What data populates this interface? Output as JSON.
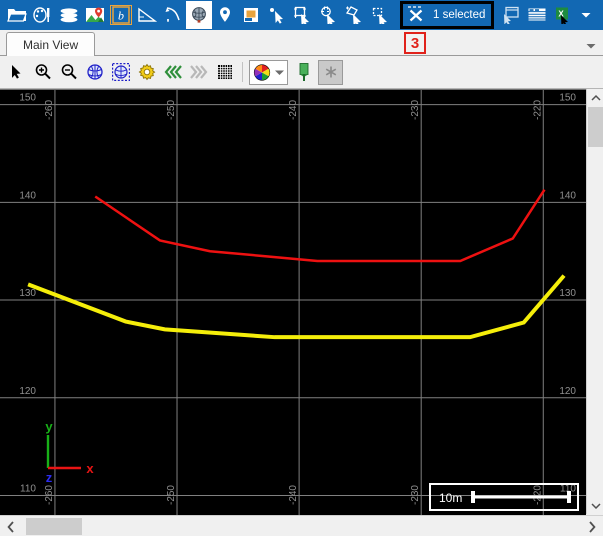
{
  "ribbon": {
    "icons": [
      {
        "name": "open-folder-icon",
        "label": "Open"
      },
      {
        "name": "palette-tools-icon",
        "label": "Design"
      },
      {
        "name": "layers-icon",
        "label": "Layers"
      },
      {
        "name": "map-pin-image-icon",
        "label": "Map"
      },
      {
        "name": "bing-maps-icon",
        "label": "Bing Maps"
      },
      {
        "name": "triangle-measure-icon",
        "label": "Measure"
      },
      {
        "name": "curve-tool-icon",
        "label": "Curve"
      },
      {
        "name": "globe-icon",
        "label": "Globe"
      },
      {
        "name": "location-pin-icon",
        "label": "Location"
      },
      {
        "name": "note-page-icon",
        "label": "Note"
      },
      {
        "name": "select-point-icon",
        "label": "Select Point"
      },
      {
        "name": "select-rectangle-icon",
        "label": "Select Rectangle"
      },
      {
        "name": "select-circle-icon",
        "label": "Select Circle"
      },
      {
        "name": "select-polygon-icon",
        "label": "Select Polygon"
      },
      {
        "name": "select-fence-icon",
        "label": "Select Fence"
      }
    ],
    "selection": {
      "icon": "deselect-x-icon",
      "label": "1 selected"
    },
    "trailing_icons": [
      {
        "name": "copy-to-view-icon",
        "label": "Copy To View"
      },
      {
        "name": "table-report-icon",
        "label": "Report"
      },
      {
        "name": "export-excel-icon",
        "label": "Export to Excel"
      }
    ],
    "overflow_caret": "chevron-down-icon",
    "accent_color": "#1268b3"
  },
  "tabbar": {
    "tabs": [
      {
        "label": "Main View",
        "active": true
      }
    ],
    "badge": "3",
    "badge_color": "#e0221b",
    "overflow_caret": "chevron-down-icon"
  },
  "viewtoolbar": {
    "buttons": [
      {
        "name": "arrow-select-icon",
        "label": "Select"
      },
      {
        "name": "zoom-in-icon",
        "label": "Zoom In"
      },
      {
        "name": "zoom-out-icon",
        "label": "Zoom Out"
      },
      {
        "name": "globe-zoom-extents-icon",
        "label": "Zoom Extents"
      },
      {
        "name": "globe-zoom-selection-icon",
        "label": "Zoom To Selection"
      },
      {
        "name": "settings-gear-icon",
        "label": "View Settings"
      },
      {
        "name": "previous-view-icon",
        "label": "Previous View"
      },
      {
        "name": "next-view-icon",
        "label": "Next View"
      },
      {
        "name": "grid-icon",
        "label": "Grid"
      }
    ],
    "color_combo": {
      "name": "color-palette-combo",
      "caret": "chevron-down-icon"
    },
    "flag_button": {
      "name": "flag-marker-icon",
      "label": "Marker"
    },
    "asterisk_button": {
      "name": "asterisk-icon",
      "label": "Annotation",
      "pressed": true
    }
  },
  "chart_data": {
    "type": "line",
    "title": "",
    "xlabel": "",
    "ylabel": "",
    "background": "#000000",
    "grid": true,
    "grid_color": "#808080",
    "legend_position": "none",
    "xlim": [
      -264.5,
      -216.5
    ],
    "ylim": [
      108.0,
      151.5
    ],
    "x_ticks_top": [
      -260,
      -250,
      -240,
      -230,
      -220
    ],
    "x_ticks_bottom": [
      -260,
      -250,
      -240,
      -230,
      -220
    ],
    "y_ticks_left": [
      150,
      140,
      130,
      120,
      110
    ],
    "y_ticks_right": [
      150,
      140,
      130,
      120,
      110
    ],
    "series": [
      {
        "name": "red-profile",
        "color": "#ee1111",
        "width": 2.5,
        "points": [
          [
            -256.7,
            140.6
          ],
          [
            -251.4,
            136.1
          ],
          [
            -247.3,
            135.0
          ],
          [
            -238.5,
            134.0
          ],
          [
            -226.8,
            134.0
          ],
          [
            -222.5,
            136.3
          ],
          [
            -219.9,
            141.3
          ]
        ]
      },
      {
        "name": "yellow-profile",
        "color": "#f5ee0a",
        "width": 4,
        "points": [
          [
            -262.2,
            131.6
          ],
          [
            -254.2,
            127.8
          ],
          [
            -251.0,
            127.0
          ],
          [
            -242.0,
            126.2
          ],
          [
            -226.0,
            126.2
          ],
          [
            -221.6,
            127.7
          ],
          [
            -218.3,
            132.5
          ]
        ]
      }
    ]
  },
  "axis_gizmo": {
    "x": {
      "label": "x",
      "color": "#e81414"
    },
    "y": {
      "label": "y",
      "color": "#18b018"
    },
    "z": {
      "label": "z",
      "color": "#2c2cf0"
    }
  },
  "scalebar": {
    "label": "10m",
    "color": "#ffffff"
  },
  "scrollbars": {
    "vertical": {
      "up": "chevron-up-icon",
      "down": "chevron-down-icon"
    },
    "horizontal": {
      "left": "chevron-left-icon",
      "right": "chevron-right-icon"
    }
  }
}
